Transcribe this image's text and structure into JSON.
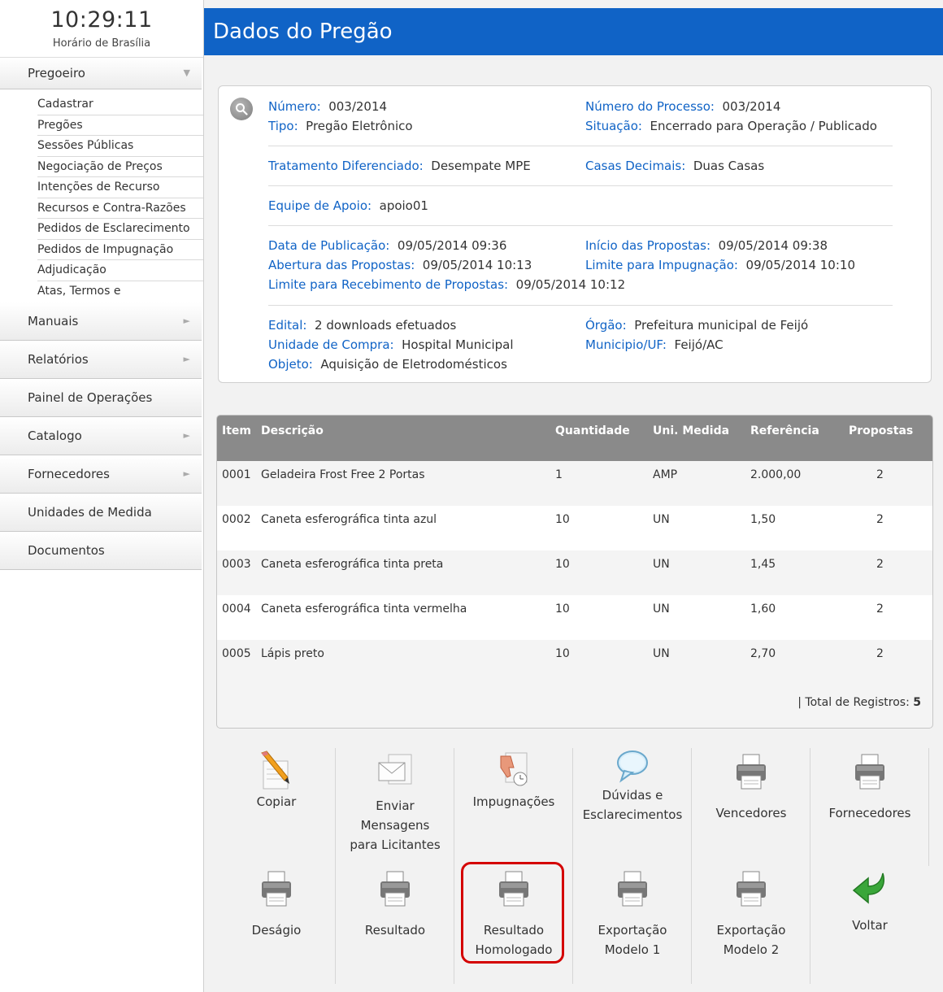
{
  "clock": {
    "time": "10:29:11",
    "label": "Horário de Brasília"
  },
  "sidebar": {
    "pregoeiro": "Pregoeiro",
    "submenu": [
      "Cadastrar",
      "Pregões",
      "Sessões Públicas",
      "Negociação de Preços",
      "Intenções de Recurso",
      "Recursos e Contra-Razões",
      "Pedidos de Esclarecimento",
      "Pedidos de Impugnação",
      "Adjudicação",
      "Atas, Termos e"
    ],
    "sections": [
      "Manuais",
      "Relatórios",
      "Painel de Operações",
      "Catalogo",
      "Fornecedores",
      "Unidades de Medida",
      "Documentos"
    ]
  },
  "page": {
    "title": "Dados do Pregão"
  },
  "info": {
    "numero": {
      "label": "Número:",
      "value": "003/2014"
    },
    "tipo": {
      "label": "Tipo:",
      "value": "Pregão Eletrônico"
    },
    "numero_processo": {
      "label": "Número do Processo:",
      "value": "003/2014"
    },
    "situacao": {
      "label": "Situação:",
      "value": "Encerrado para Operação / Publicado"
    },
    "tratamento": {
      "label": "Tratamento Diferenciado:",
      "value": "Desempate MPE"
    },
    "casas": {
      "label": "Casas Decimais:",
      "value": "Duas Casas"
    },
    "equipe": {
      "label": "Equipe de Apoio:",
      "value": "apoio01"
    },
    "data_publicacao": {
      "label": "Data de Publicação:",
      "value": "09/05/2014 09:36"
    },
    "abertura": {
      "label": "Abertura das Propostas:",
      "value": "09/05/2014 10:13"
    },
    "limite_recebimento": {
      "label": "Limite para Recebimento de Propostas:",
      "value": "09/05/2014 10:12"
    },
    "inicio": {
      "label": "Início das Propostas:",
      "value": "09/05/2014 09:38"
    },
    "limite_impugnacao": {
      "label": "Limite para Impugnação:",
      "value": "09/05/2014 10:10"
    },
    "edital": {
      "label": "Edital:",
      "value": "2 downloads efetuados"
    },
    "unidade": {
      "label": "Unidade de Compra:",
      "value": "Hospital Municipal"
    },
    "objeto": {
      "label": "Objeto:",
      "value": "Aquisição de Eletrodomésticos"
    },
    "orgao": {
      "label": "Órgão:",
      "value": "Prefeitura municipal de Feijó"
    },
    "municipio": {
      "label": "Municipio/UF:",
      "value": "Feijó/AC"
    }
  },
  "table": {
    "headers": [
      "Item",
      "Descrição",
      "Quantidade",
      "Uni. Medida",
      "Referência",
      "Propostas"
    ],
    "rows": [
      [
        "0001",
        "Geladeira Frost Free 2 Portas",
        "1",
        "AMP",
        "2.000,00",
        "2"
      ],
      [
        "0002",
        "Caneta esferográfica tinta azul",
        "10",
        "UN",
        "1,50",
        "2"
      ],
      [
        "0003",
        "Caneta esferográfica tinta preta",
        "10",
        "UN",
        "1,45",
        "2"
      ],
      [
        "0004",
        "Caneta esferográfica tinta vermelha",
        "10",
        "UN",
        "1,60",
        "2"
      ],
      [
        "0005",
        "Lápis preto",
        "10",
        "UN",
        "2,70",
        "2"
      ]
    ],
    "footer_label": "| Total de Registros:",
    "footer_total": "5"
  },
  "actions": {
    "copiar": [
      "Copiar"
    ],
    "enviar": [
      "Enviar",
      "Mensagens",
      "para Licitantes"
    ],
    "impugnacoes": [
      "Impugnações"
    ],
    "duvidas": [
      "Dúvidas e",
      "Esclarecimentos"
    ],
    "vencedores": [
      "Vencedores"
    ],
    "fornecedores": [
      "Fornecedores"
    ],
    "desagio": [
      "Deságio"
    ],
    "resultado": [
      "Resultado"
    ],
    "resultado_homologado": [
      "Resultado",
      "Homologado"
    ],
    "exportacao1": [
      "Exportação",
      "Modelo 1"
    ],
    "exportacao2": [
      "Exportação",
      "Modelo 2"
    ],
    "voltar": [
      "Voltar"
    ]
  },
  "icons": {
    "clock": "none",
    "menu_collapse": "double-chevron-down-icon",
    "menu_expand": "double-chevron-right-icon",
    "info": "search-icon",
    "copiar": "pencil-paper-icon",
    "enviar": "envelope-icon",
    "impugnacoes": "thumbs-down-clock-icon",
    "duvidas": "speech-bubble-icon",
    "print": "printer-icon",
    "voltar": "green-return-arrow-icon"
  },
  "colors": {
    "accent": "#1063c6",
    "label": "#1063c6",
    "highlight": "#d40000",
    "table_header": "#8a8a8a",
    "arrow": "#3aa63a"
  }
}
